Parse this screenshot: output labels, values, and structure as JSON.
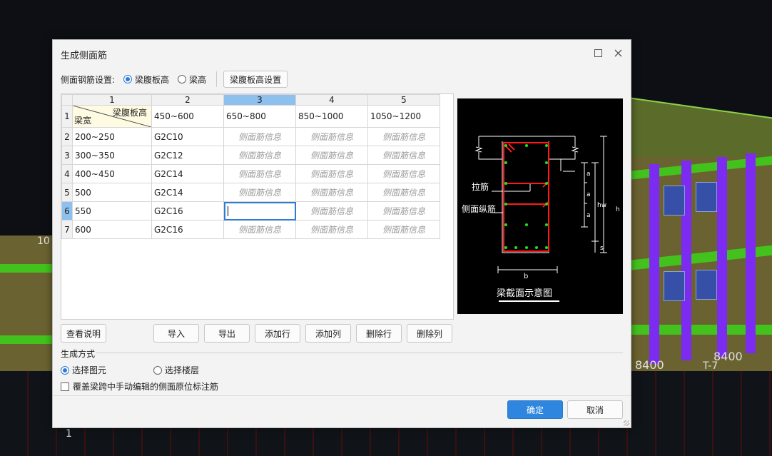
{
  "dialog": {
    "title": "生成侧面筋",
    "setting_label": "侧面钢筋设置:",
    "radio_web_height": "梁腹板高",
    "radio_beam_height": "梁高",
    "web_height_button": "梁腹板高设置"
  },
  "table": {
    "col_numbers": [
      "1",
      "2",
      "3",
      "4",
      "5"
    ],
    "corner_top": "梁腹板高",
    "corner_bottom": "梁宽",
    "header_values": [
      "450~600",
      "650~800",
      "850~1000",
      "1050~1200"
    ],
    "rows": [
      {
        "num": "1"
      },
      {
        "num": "2",
        "width": "200~250",
        "c2": "G2C10",
        "c3": "侧面筋信息",
        "c4": "侧面筋信息",
        "c5": "侧面筋信息"
      },
      {
        "num": "3",
        "width": "300~350",
        "c2": "G2C12",
        "c3": "侧面筋信息",
        "c4": "侧面筋信息",
        "c5": "侧面筋信息"
      },
      {
        "num": "4",
        "width": "400~450",
        "c2": "G2C14",
        "c3": "侧面筋信息",
        "c4": "侧面筋信息",
        "c5": "侧面筋信息"
      },
      {
        "num": "5",
        "width": "500",
        "c2": "G2C14",
        "c3": "侧面筋信息",
        "c4": "侧面筋信息",
        "c5": "侧面筋信息"
      },
      {
        "num": "6",
        "width": "550",
        "c2": "G2C16",
        "c3": "",
        "c4": "侧面筋信息",
        "c5": "侧面筋信息"
      },
      {
        "num": "7",
        "width": "600",
        "c2": "G2C16",
        "c3": "侧面筋信息",
        "c4": "侧面筋信息",
        "c5": "侧面筋信息"
      }
    ],
    "selected_column": "3",
    "selected_row": "6"
  },
  "diagram": {
    "label_tie": "拉筋",
    "label_side_bar": "侧面纵筋",
    "label_a": "a",
    "label_hw": "hw",
    "label_h": "h",
    "label_s": "s",
    "label_b": "b",
    "caption": "梁截面示意图"
  },
  "buttons": {
    "help": "查看说明",
    "import": "导入",
    "export": "导出",
    "add_row": "添加行",
    "add_col": "添加列",
    "del_row": "删除行",
    "del_col": "删除列",
    "ok": "确定",
    "cancel": "取消"
  },
  "generate": {
    "title": "生成方式",
    "opt_select_element": "选择图元",
    "opt_select_floor": "选择楼层",
    "overwrite_label": "覆盖梁跨中手动编辑的侧面原位标注筋"
  },
  "background": {
    "dim1": "8400",
    "dim2": "8400",
    "axis": "T-7",
    "num_left": "10",
    "num_bottom": "1"
  },
  "colors": {
    "accent": "#2e86de",
    "selection": "#8ec0ee",
    "rebar_red": "#ff1a1a",
    "rebar_green": "#19e619"
  }
}
